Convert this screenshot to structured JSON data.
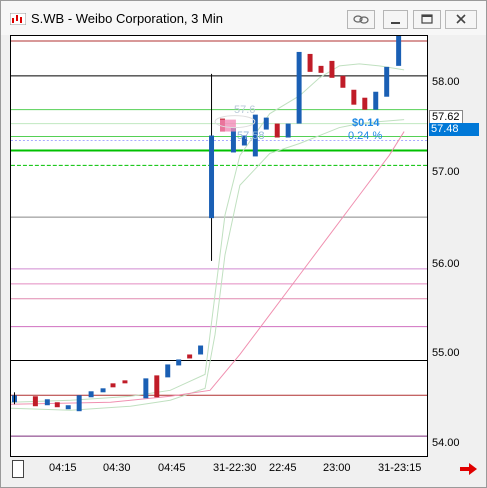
{
  "window": {
    "title": "S.WB - Weibo Corporation, 3 Min"
  },
  "y_axis": {
    "ticks": [
      "58.00",
      "57.00",
      "56.00",
      "55.00",
      "54.00"
    ],
    "last_price_tag": "57.62",
    "current_price_tag": "57.48"
  },
  "x_axis": {
    "ticks": [
      "04:15",
      "04:30",
      "04:45",
      "31-22:30",
      "22:45",
      "23:00",
      "31-23:15"
    ]
  },
  "annotations": {
    "change": "$0.14",
    "percent": "0.24 %",
    "faint1": "57.6",
    "faint2": "57.58"
  },
  "colors": {
    "up": "#1a5fb4",
    "down": "#c01c28",
    "accent": "#1e88e5",
    "price_tag_bg": "#0078d7"
  },
  "icons": [
    "app-icon",
    "link-icon",
    "minimize-icon",
    "maximize-icon",
    "close-icon",
    "arrow-right-icon"
  ]
}
